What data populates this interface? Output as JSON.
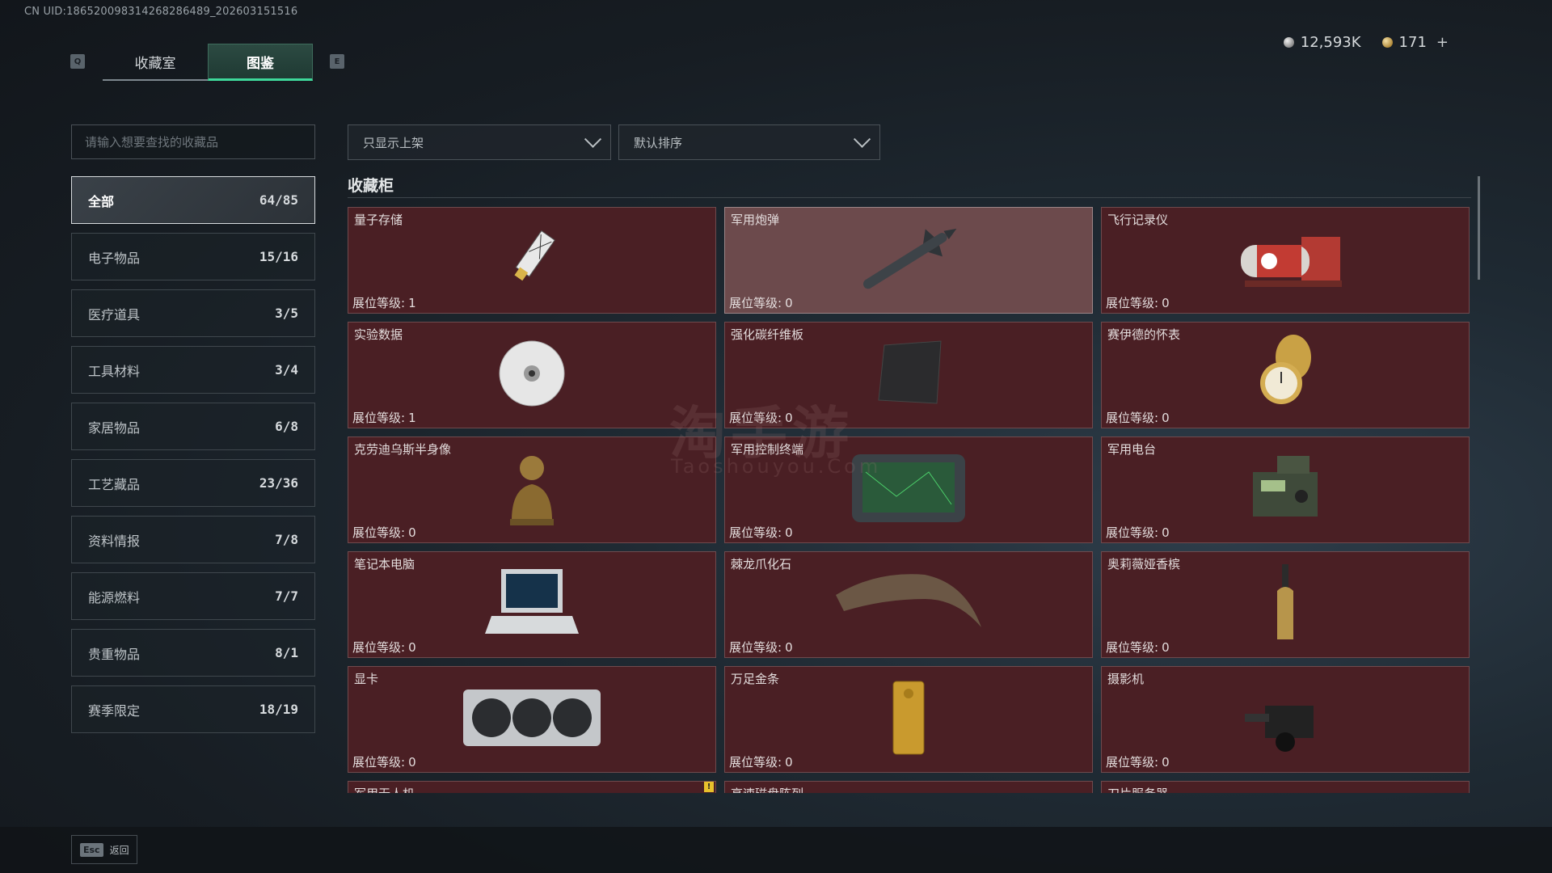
{
  "uid_text": "CN UID:186520098314268286489_202603151516",
  "currency": {
    "silver": "12,593K",
    "gold": "171",
    "add": "+"
  },
  "tabs": {
    "left_key": "Q",
    "right_key": "E",
    "items": [
      "收藏室",
      "图鉴"
    ],
    "active": "图鉴"
  },
  "search": {
    "placeholder": "请输入想要查找的收藏品"
  },
  "categories": [
    {
      "label": "全部",
      "count": "64/85",
      "active": true
    },
    {
      "label": "电子物品",
      "count": "15/16"
    },
    {
      "label": "医疗道具",
      "count": "3/5"
    },
    {
      "label": "工具材料",
      "count": "3/4"
    },
    {
      "label": "家居物品",
      "count": "6/8"
    },
    {
      "label": "工艺藏品",
      "count": "23/36"
    },
    {
      "label": "资料情报",
      "count": "7/8"
    },
    {
      "label": "能源燃料",
      "count": "7/7"
    },
    {
      "label": "贵重物品",
      "count": "8/1"
    },
    {
      "label": "赛季限定",
      "count": "18/19"
    }
  ],
  "filter": {
    "label": "只显示上架"
  },
  "sort": {
    "label": "默认排序"
  },
  "section_title": "收藏柜",
  "level_label": "展位等级:",
  "items": [
    {
      "name": "量子存储",
      "level": "1",
      "icon": "usb-drive-icon"
    },
    {
      "name": "军用炮弹",
      "level": "0",
      "icon": "missile-icon",
      "highlighted": true
    },
    {
      "name": "飞行记录仪",
      "level": "0",
      "icon": "flight-recorder-icon"
    },
    {
      "name": "实验数据",
      "level": "1",
      "icon": "disc-icon"
    },
    {
      "name": "强化碳纤维板",
      "level": "0",
      "icon": "carbon-plate-icon"
    },
    {
      "name": "赛伊德的怀表",
      "level": "0",
      "icon": "pocket-watch-icon"
    },
    {
      "name": "克劳迪乌斯半身像",
      "level": "0",
      "icon": "bust-icon"
    },
    {
      "name": "军用控制终端",
      "level": "0",
      "icon": "control-terminal-icon"
    },
    {
      "name": "军用电台",
      "level": "0",
      "icon": "radio-icon"
    },
    {
      "name": "笔记本电脑",
      "level": "0",
      "icon": "laptop-icon"
    },
    {
      "name": "棘龙爪化石",
      "level": "0",
      "icon": "claw-fossil-icon"
    },
    {
      "name": "奥莉薇娅香槟",
      "level": "0",
      "icon": "champagne-icon"
    },
    {
      "name": "显卡",
      "level": "0",
      "icon": "gpu-icon"
    },
    {
      "name": "万足金条",
      "level": "0",
      "icon": "gold-bar-icon"
    },
    {
      "name": "摄影机",
      "level": "0",
      "icon": "camera-icon"
    },
    {
      "name": "军用无人机",
      "level": "",
      "icon": "drone-icon",
      "warning": true
    },
    {
      "name": "高速磁盘阵列",
      "level": "",
      "icon": "disk-array-icon"
    },
    {
      "name": "刀片服务器",
      "level": "",
      "icon": "blade-server-icon"
    }
  ],
  "footer": {
    "key": "Esc",
    "label": "返回"
  },
  "watermark": {
    "cn": "淘手游",
    "en": "Taoshouyou.Com"
  },
  "colors": {
    "card_bg": "#4a1f24",
    "accent_tab": "#3ed89a"
  }
}
